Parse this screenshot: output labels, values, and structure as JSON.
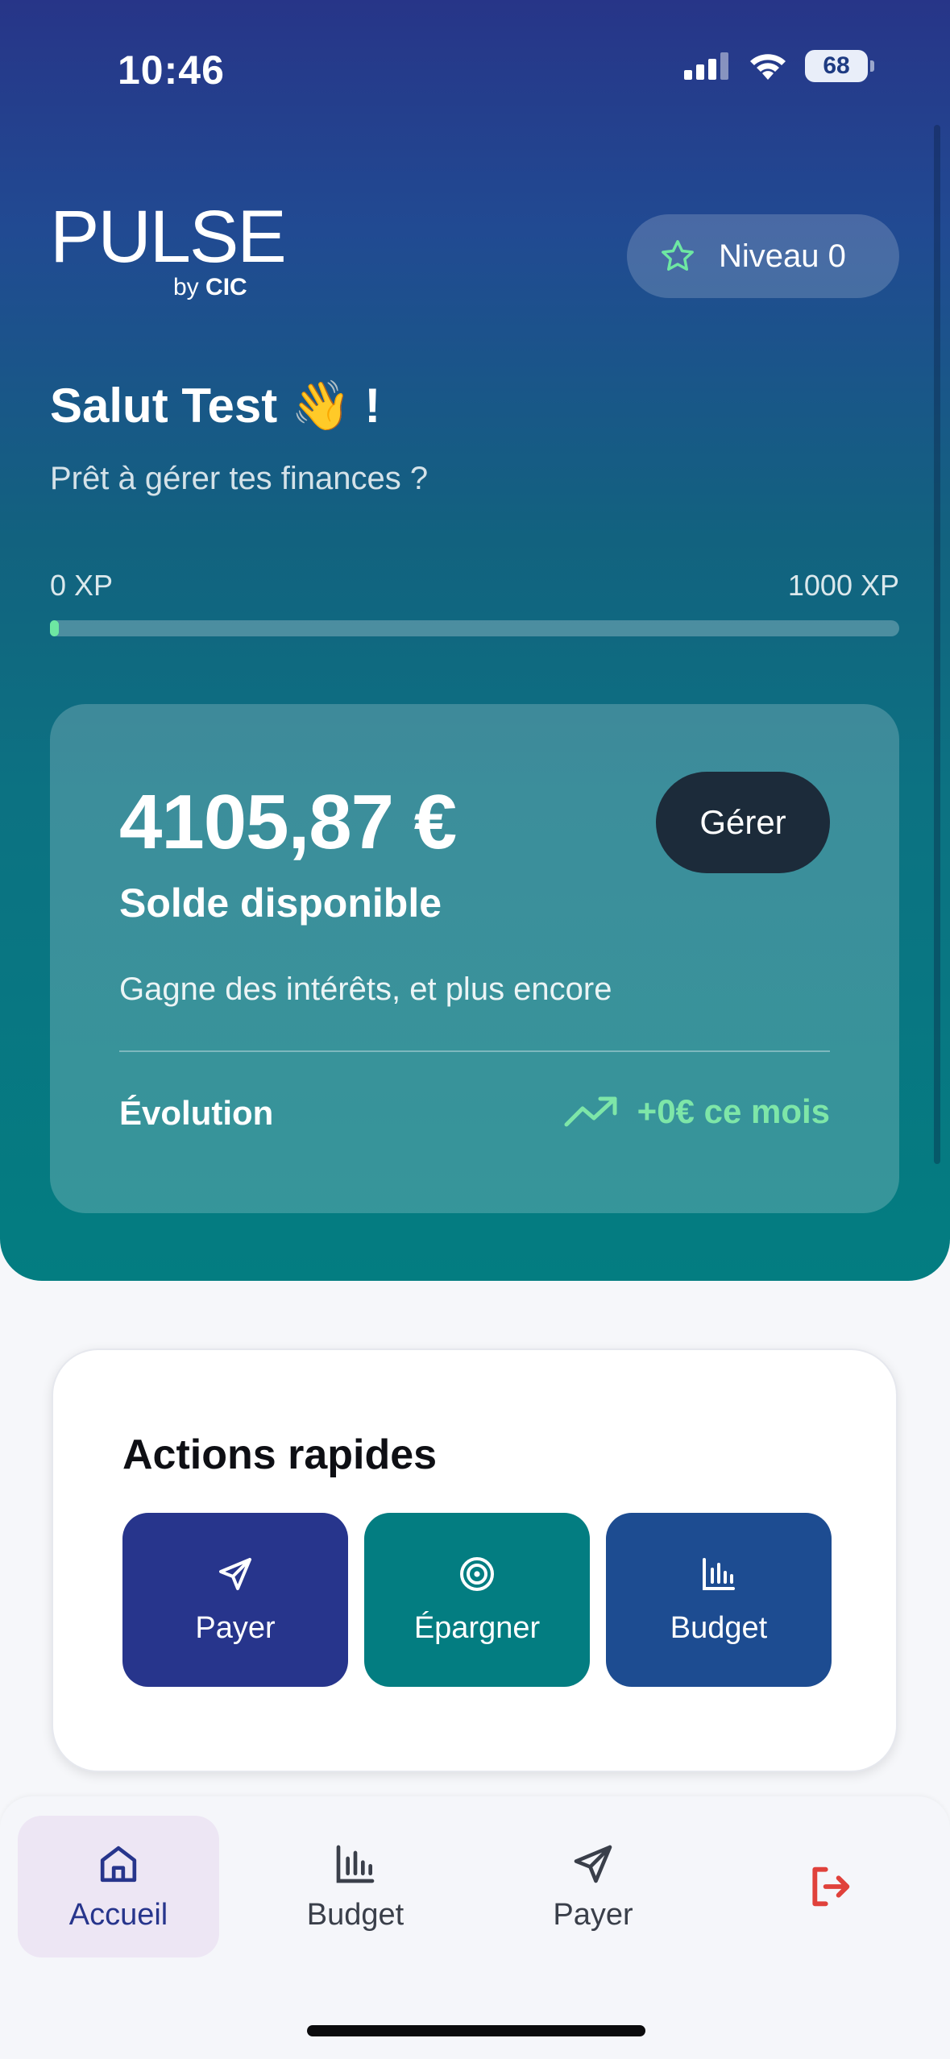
{
  "status_bar": {
    "time": "10:46",
    "battery": "68"
  },
  "logo": {
    "main": "PULSE",
    "by": "by",
    "brand": "CIC"
  },
  "level": {
    "label": "Niveau 0"
  },
  "greeting": {
    "title": "Salut Test 👋 !",
    "subtitle": "Prêt à gérer tes finances ?"
  },
  "xp": {
    "min_label": "0 XP",
    "max_label": "1000 XP",
    "progress": 0.01
  },
  "balance": {
    "amount": "4105,87 €",
    "label": "Solde disponible",
    "manage_label": "Gérer",
    "promo": "Gagne des intérêts, et plus encore",
    "evolution_label": "Évolution",
    "evolution_value": "+0€ ce mois"
  },
  "quick_actions": {
    "title": "Actions rapides",
    "items": [
      {
        "label": "Payer",
        "icon": "send-icon",
        "color": "#27358c"
      },
      {
        "label": "Épargner",
        "icon": "target-icon",
        "color": "#037d81"
      },
      {
        "label": "Budget",
        "icon": "bar-chart-icon",
        "color": "#1d4c91"
      }
    ]
  },
  "nav": {
    "items": [
      {
        "label": "Accueil",
        "icon": "home-icon",
        "active": true
      },
      {
        "label": "Budget",
        "icon": "bar-chart-icon"
      },
      {
        "label": "Payer",
        "icon": "send-icon"
      },
      {
        "label": "",
        "icon": "logout-icon"
      }
    ]
  },
  "colors": {
    "accent_green": "#7ee6a8",
    "logout_red": "#e0413b",
    "primary": "#27358c"
  }
}
